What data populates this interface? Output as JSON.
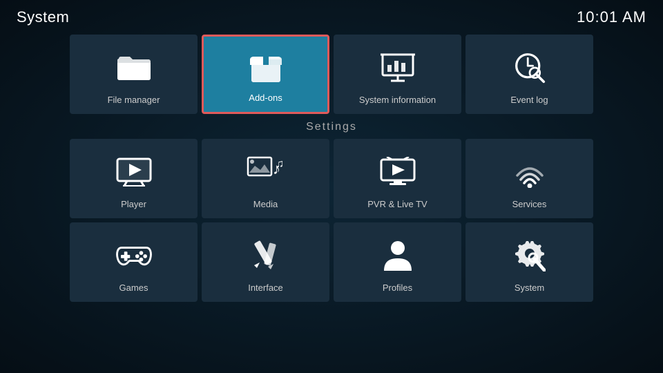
{
  "header": {
    "title": "System",
    "time": "10:01 AM"
  },
  "top_row": [
    {
      "id": "file-manager",
      "label": "File manager",
      "icon": "folder"
    },
    {
      "id": "add-ons",
      "label": "Add-ons",
      "icon": "box",
      "active": true
    },
    {
      "id": "system-information",
      "label": "System information",
      "icon": "chart"
    },
    {
      "id": "event-log",
      "label": "Event log",
      "icon": "clock"
    }
  ],
  "section_title": "Settings",
  "settings_rows": [
    [
      {
        "id": "player",
        "label": "Player",
        "icon": "player"
      },
      {
        "id": "media",
        "label": "Media",
        "icon": "media"
      },
      {
        "id": "pvr-live-tv",
        "label": "PVR & Live TV",
        "icon": "pvr"
      },
      {
        "id": "services",
        "label": "Services",
        "icon": "services"
      }
    ],
    [
      {
        "id": "games",
        "label": "Games",
        "icon": "games"
      },
      {
        "id": "interface",
        "label": "Interface",
        "icon": "interface"
      },
      {
        "id": "profiles",
        "label": "Profiles",
        "icon": "profiles"
      },
      {
        "id": "system",
        "label": "System",
        "icon": "system"
      }
    ]
  ]
}
